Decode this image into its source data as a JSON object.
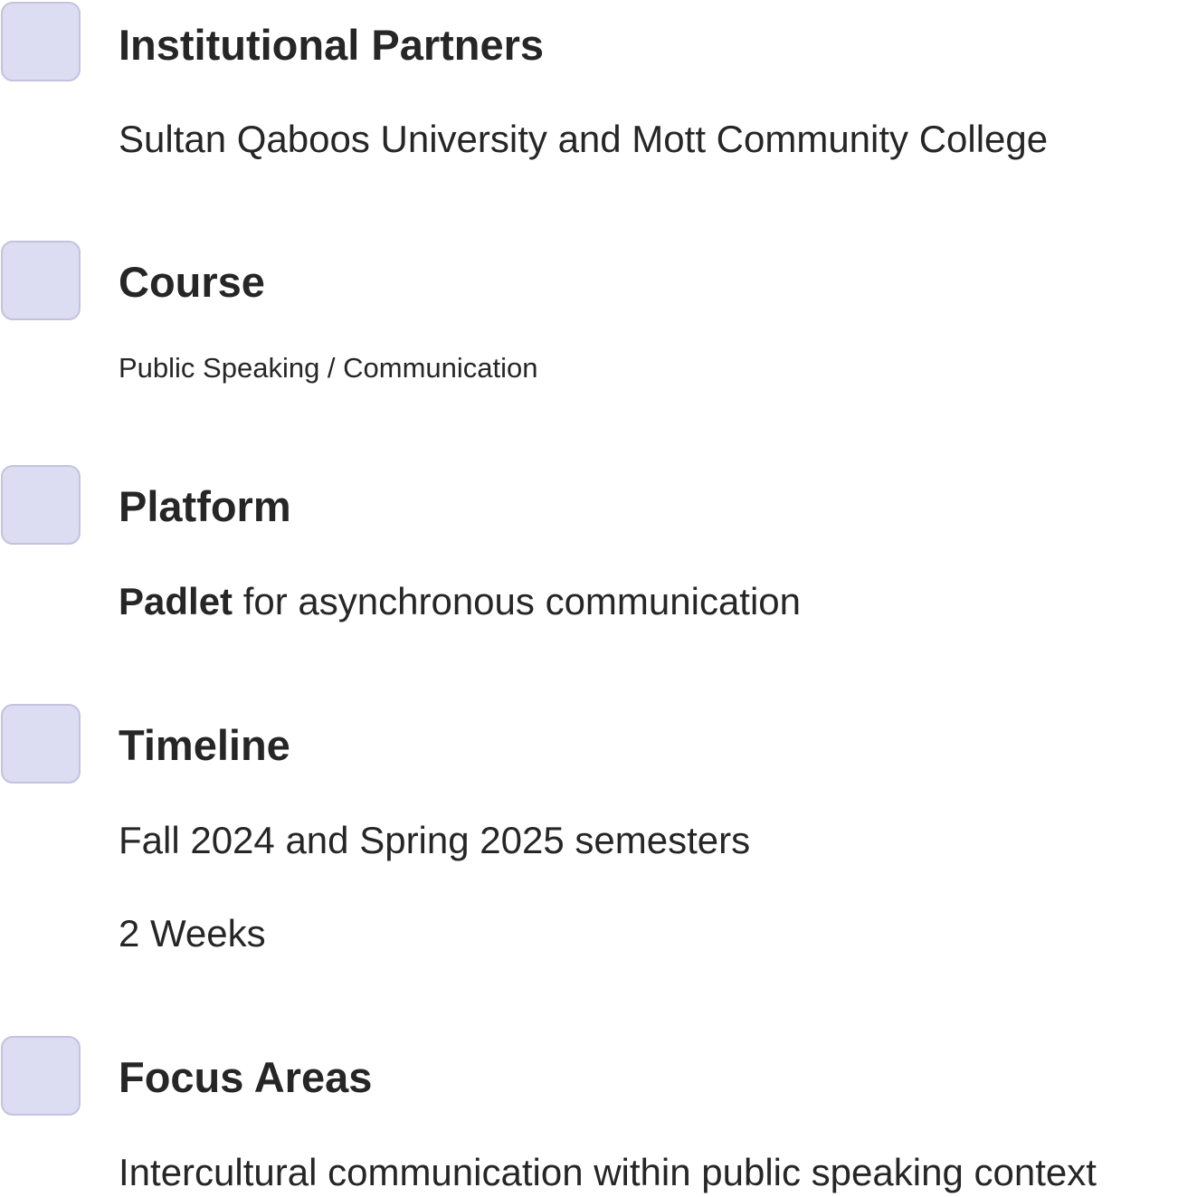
{
  "sections": [
    {
      "heading": "Institutional Partners",
      "lines": [
        "Sultan Qaboos University and Mott Community College"
      ]
    },
    {
      "heading": "Course",
      "lines": [
        "Public Speaking / Communication"
      ]
    },
    {
      "heading": "Platform",
      "lines": [
        {
          "bold": "Padlet",
          "rest": " for asynchronous communication"
        }
      ]
    },
    {
      "heading": "Timeline",
      "lines": [
        "Fall 2024 and Spring 2025 semesters",
        "2 Weeks"
      ]
    },
    {
      "heading": "Focus Areas",
      "lines": [
        "Intercultural communication within public speaking context"
      ]
    }
  ],
  "colors": {
    "marker_fill": "#dcdcf2",
    "marker_border": "#c3c3df",
    "text": "#262626"
  }
}
